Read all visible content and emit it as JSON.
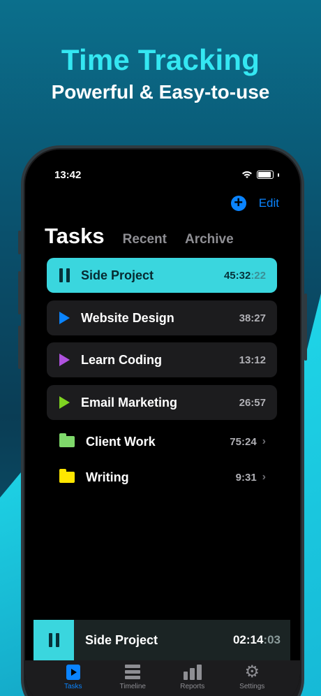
{
  "hero": {
    "title": "Time Tracking",
    "subtitle": "Powerful & Easy-to-use"
  },
  "status_bar": {
    "time": "13:42"
  },
  "toolbar": {
    "edit_label": "Edit",
    "add_icon": "plus-circle-icon"
  },
  "tabs": {
    "active": "Tasks",
    "recent": "Recent",
    "archive": "Archive"
  },
  "tasks": [
    {
      "name": "Side Project",
      "time_main": "45:32",
      "time_sec": ":22",
      "state": "running",
      "color": "#3ad6de"
    },
    {
      "name": "Website Design",
      "time_main": "38:27",
      "state": "paused",
      "color": "#0a84ff"
    },
    {
      "name": "Learn Coding",
      "time_main": "13:12",
      "state": "paused",
      "color": "#af52de"
    },
    {
      "name": "Email Marketing",
      "time_main": "26:57",
      "state": "paused",
      "color": "#7ed321"
    }
  ],
  "folders": [
    {
      "name": "Client Work",
      "time": "75:24",
      "color": "#7fd96b"
    },
    {
      "name": "Writing",
      "time": "9:31",
      "color": "#ffe600"
    }
  ],
  "now_playing": {
    "name": "Side Project",
    "time_main": "02:14",
    "time_sec": ":03"
  },
  "tabbar": {
    "tasks": "Tasks",
    "timeline": "Timeline",
    "reports": "Reports",
    "settings": "Settings"
  }
}
